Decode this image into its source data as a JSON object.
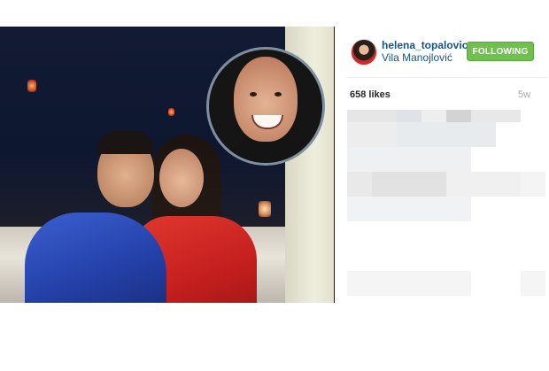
{
  "post": {
    "username": "helena_topalovic",
    "location": "Vila Manojlović",
    "follow_label": "FOLLOWING",
    "likes": "658 likes",
    "time_ago": "5w"
  },
  "colors": {
    "link": "#125688",
    "follow_button": "#70c050",
    "muted": "#a5a7aa"
  }
}
